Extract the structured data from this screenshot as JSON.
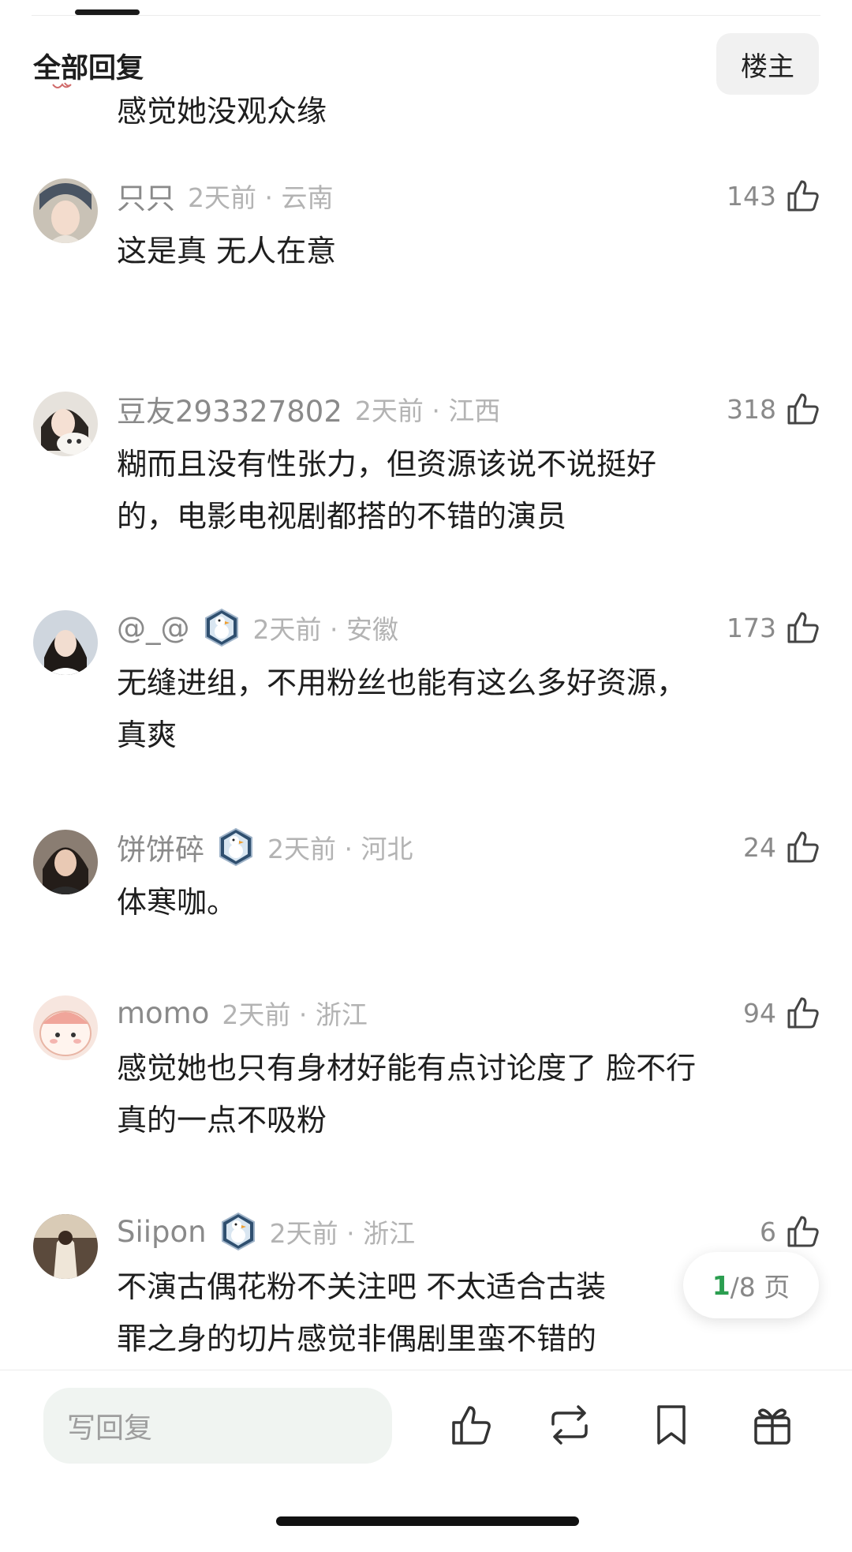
{
  "header": {
    "title": "全部回复",
    "op_filter_label": "楼主"
  },
  "comments": [
    {
      "text_lines": [
        "感觉她没观众缘"
      ]
    },
    {
      "username": "只只",
      "time_loc": "2天前 · 云南",
      "likes": "143",
      "text_lines": [
        "这是真 无人在意"
      ]
    },
    {
      "username": "豆友293327802",
      "time_loc": "2天前 · 江西",
      "likes": "318",
      "text_lines": [
        "糊而且没有性张力，但资源该说不说挺好",
        "的，电影电视剧都搭的不错的演员"
      ]
    },
    {
      "username": "@_@",
      "time_loc": "2天前 · 安徽",
      "likes": "173",
      "text_lines": [
        "无缝进组，不用粉丝也能有这么多好资源，",
        "真爽"
      ]
    },
    {
      "username": "饼饼碎",
      "time_loc": "2天前 · 河北",
      "likes": "24",
      "text_lines": [
        "体寒咖。"
      ]
    },
    {
      "username": "momo",
      "time_loc": "2天前 · 浙江",
      "likes": "94",
      "text_lines": [
        "感觉她也只有身材好能有点讨论度了 脸不行",
        "真的一点不吸粉"
      ]
    },
    {
      "username": "Siipon",
      "time_loc": "2天前 · 浙江",
      "likes": "6",
      "text_lines": [
        "不演古偶花粉不关注吧 不太适合古装",
        "罪之身的切片感觉非偶剧里蛮不错的"
      ]
    }
  ],
  "pagination": {
    "current": "1",
    "total_text": "/8 页"
  },
  "bottom_bar": {
    "reply_placeholder": "写回复"
  },
  "icons": {
    "like": "thumbs-up-icon",
    "repost": "repost-icon",
    "bookmark": "bookmark-icon",
    "gift": "gift-icon",
    "badge": "goose-badge-icon"
  },
  "colors": {
    "accent_green": "#2b9e50",
    "muted_text": "#8a8a8a",
    "input_bg": "#f0f4f1"
  }
}
